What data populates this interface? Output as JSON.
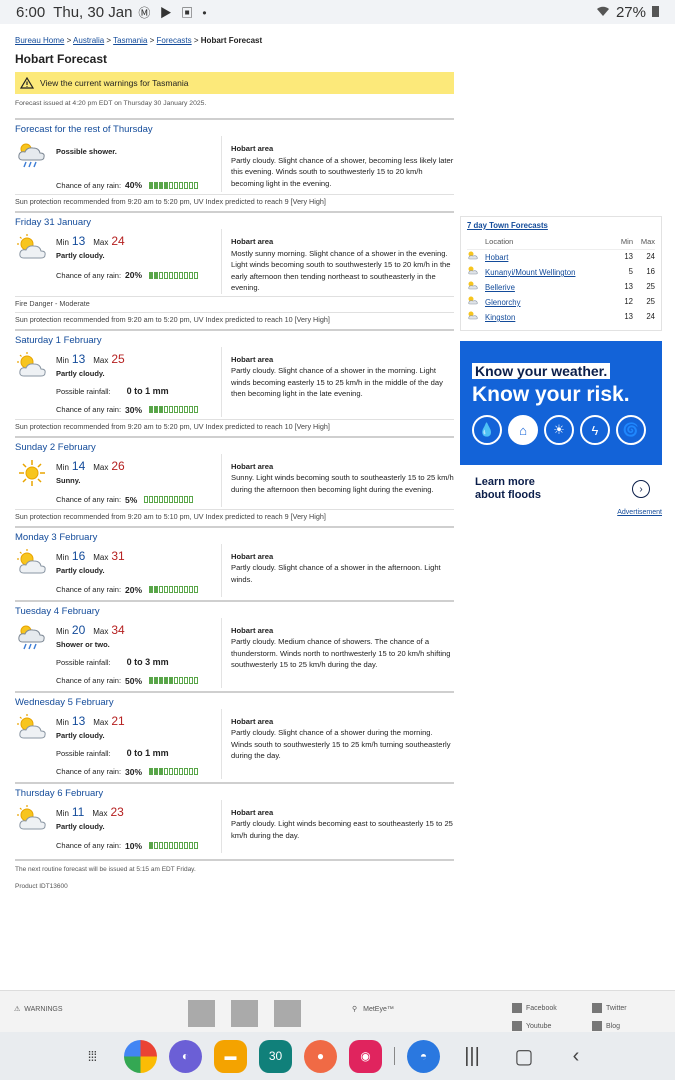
{
  "statusbar": {
    "time": "6:00",
    "date": "Thu, 30 Jan",
    "notif_icons": "Ⓜ ▶ ▣ •",
    "battery": "27%"
  },
  "breadcrumb": {
    "items": [
      "Bureau Home",
      "Australia",
      "Tasmania",
      "Forecasts"
    ],
    "current": "Hobart Forecast",
    "sep": " > "
  },
  "title": "Hobart Forecast",
  "warning": "View the current warnings for Tasmania",
  "issued": "Forecast issued at 4:20 pm EDT on Thursday 30 January 2025.",
  "labels": {
    "min": "Min",
    "max": "Max",
    "chance": "Chance of any rain:",
    "possible": "Possible rainfall:",
    "area": "Hobart area"
  },
  "days": [
    {
      "header": "Forecast for the rest of Thursday",
      "icon": "shower",
      "desc": "Possible shower.",
      "rain": "40%",
      "rain_level": 4,
      "text": "Partly cloudy. Slight chance of a shower, becoming less likely later this evening. Winds south to southwesterly 15 to 20 km/h becoming light in the evening.",
      "notes": [
        "Sun protection recommended from 9:20 am to 5:20 pm, UV Index predicted to reach 9 [Very High]"
      ]
    },
    {
      "header": "Friday 31 January",
      "icon": "partly-cloudy",
      "min": "13",
      "max": "24",
      "desc": "Partly cloudy.",
      "rain": "20%",
      "rain_level": 2,
      "text": "Mostly sunny morning. Slight chance of a shower in the evening. Light winds becoming south to southwesterly 15 to 20 km/h in the early afternoon then tending northeast to southeasterly in the evening.",
      "notes": [
        "Fire Danger - Moderate",
        "Sun protection recommended from 9:20 am to 5:20 pm, UV Index predicted to reach 10 [Very High]"
      ]
    },
    {
      "header": "Saturday 1 February",
      "icon": "partly-cloudy",
      "min": "13",
      "max": "25",
      "desc": "Partly cloudy.",
      "possible": "0 to 1 mm",
      "rain": "30%",
      "rain_level": 3,
      "text": "Partly cloudy. Slight chance of a shower in the morning. Light winds becoming easterly 15 to 25 km/h in the middle of the day then becoming light in the late evening.",
      "notes": [
        "Sun protection recommended from 9:20 am to 5:20 pm, UV Index predicted to reach 10 [Very High]"
      ]
    },
    {
      "header": "Sunday 2 February",
      "icon": "sunny",
      "min": "14",
      "max": "26",
      "desc": "Sunny.",
      "rain": "5%",
      "rain_level": 0,
      "text": "Sunny. Light winds becoming south to southeasterly 15 to 25 km/h during the afternoon then becoming light during the evening.",
      "notes": [
        "Sun protection recommended from 9:20 am to 5:10 pm, UV Index predicted to reach 9 [Very High]"
      ]
    },
    {
      "header": "Monday 3 February",
      "icon": "partly-cloudy",
      "min": "16",
      "max": "31",
      "desc": "Partly cloudy.",
      "rain": "20%",
      "rain_level": 2,
      "text": "Partly cloudy. Slight chance of a shower in the afternoon. Light winds.",
      "notes": []
    },
    {
      "header": "Tuesday 4 February",
      "icon": "shower",
      "min": "20",
      "max": "34",
      "desc": "Shower or two.",
      "possible": "0 to 3 mm",
      "rain": "50%",
      "rain_level": 5,
      "text": "Partly cloudy. Medium chance of showers. The chance of a thunderstorm. Winds north to northwesterly 15 to 20 km/h shifting southwesterly 15 to 25 km/h during the day.",
      "notes": []
    },
    {
      "header": "Wednesday 5 February",
      "icon": "partly-cloudy",
      "min": "13",
      "max": "21",
      "desc": "Partly cloudy.",
      "possible": "0 to 1 mm",
      "rain": "30%",
      "rain_level": 3,
      "text": "Partly cloudy. Slight chance of a shower during the morning. Winds south to southwesterly 15 to 25 km/h turning southeasterly during the day.",
      "notes": []
    },
    {
      "header": "Thursday 6 February",
      "icon": "partly-cloudy",
      "min": "11",
      "max": "23",
      "desc": "Partly cloudy.",
      "rain": "10%",
      "rain_level": 1,
      "text": "Partly cloudy. Light winds becoming east to southeasterly 15 to 25 km/h during the day.",
      "notes": []
    }
  ],
  "next_forecast": "The next routine forecast will be issued at 5:15 am EDT Friday.",
  "product": "Product IDT13600",
  "towns": {
    "title": "7 day Town Forecasts",
    "headers": [
      "Location",
      "Min",
      "Max"
    ],
    "rows": [
      {
        "name": "Hobart",
        "min": "13",
        "max": "24"
      },
      {
        "name": "Kunanyi/Mount Wellington",
        "min": "5",
        "max": "16"
      },
      {
        "name": "Bellerive",
        "min": "13",
        "max": "25"
      },
      {
        "name": "Glenorchy",
        "min": "12",
        "max": "25"
      },
      {
        "name": "Kingston",
        "min": "13",
        "max": "24"
      }
    ]
  },
  "ad": {
    "line1": "Know your weather.",
    "line2": "Know your risk.",
    "cta": "Learn more about floods",
    "label": "Advertisement"
  },
  "footer": {
    "warnings": "WARNINGS",
    "meteye": "MetEye™",
    "facebook": "Facebook",
    "twitter": "Twitter",
    "youtube": "Youtube",
    "blog": "Blog"
  },
  "navbar": {
    "calendar": "30"
  },
  "colors": {
    "link": "#134b9a",
    "warning_bg": "#fce97a",
    "rain_bar": "#5aa64a",
    "max_temp": "#b52020",
    "ad_bg": "#1363d8"
  }
}
